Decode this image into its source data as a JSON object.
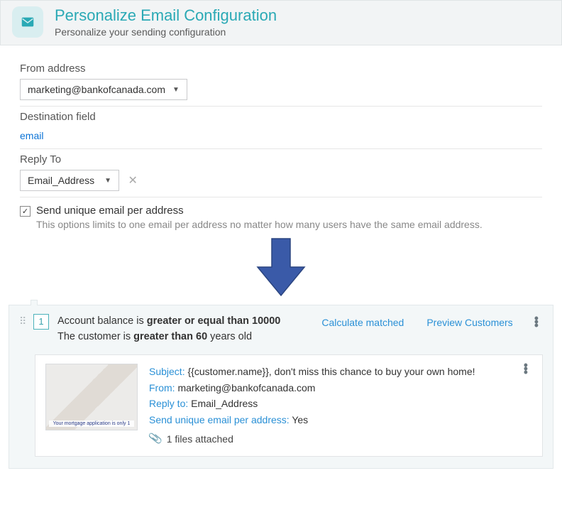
{
  "header": {
    "title": "Personalize Email Configuration",
    "subtitle": "Personalize your sending configuration"
  },
  "form": {
    "from_label": "From address",
    "from_value": "marketing@bankofcanada.com",
    "dest_label": "Destination field",
    "dest_value": "email",
    "reply_label": "Reply To",
    "reply_value": "Email_Address",
    "unique_label": "Send unique email per address",
    "unique_desc": "This options limits to one email per address no matter how many users have the same email ad­dress."
  },
  "rule": {
    "number": "1",
    "line1_pre": "Account balance is ",
    "line1_bold": "greater or equal than 10000",
    "line2_pre": "The customer is ",
    "line2_bold": "greater than 60",
    "line2_post": " years old",
    "calc": "Calculate matched",
    "preview": "Preview Customers"
  },
  "email": {
    "subject_label": "Subject: ",
    "subject_value": "{{customer.name}}, don't miss this chance to buy your own home!",
    "from_label": "From: ",
    "from_value": "marketing@bankofcanada.com",
    "reply_label": "Reply to: ",
    "reply_value": "Email_Address",
    "unique_label": "Send unique email per address: ",
    "unique_value": "Yes",
    "attach": "1 files attached",
    "thumb_caption": "Your mortgage application is only 1"
  }
}
